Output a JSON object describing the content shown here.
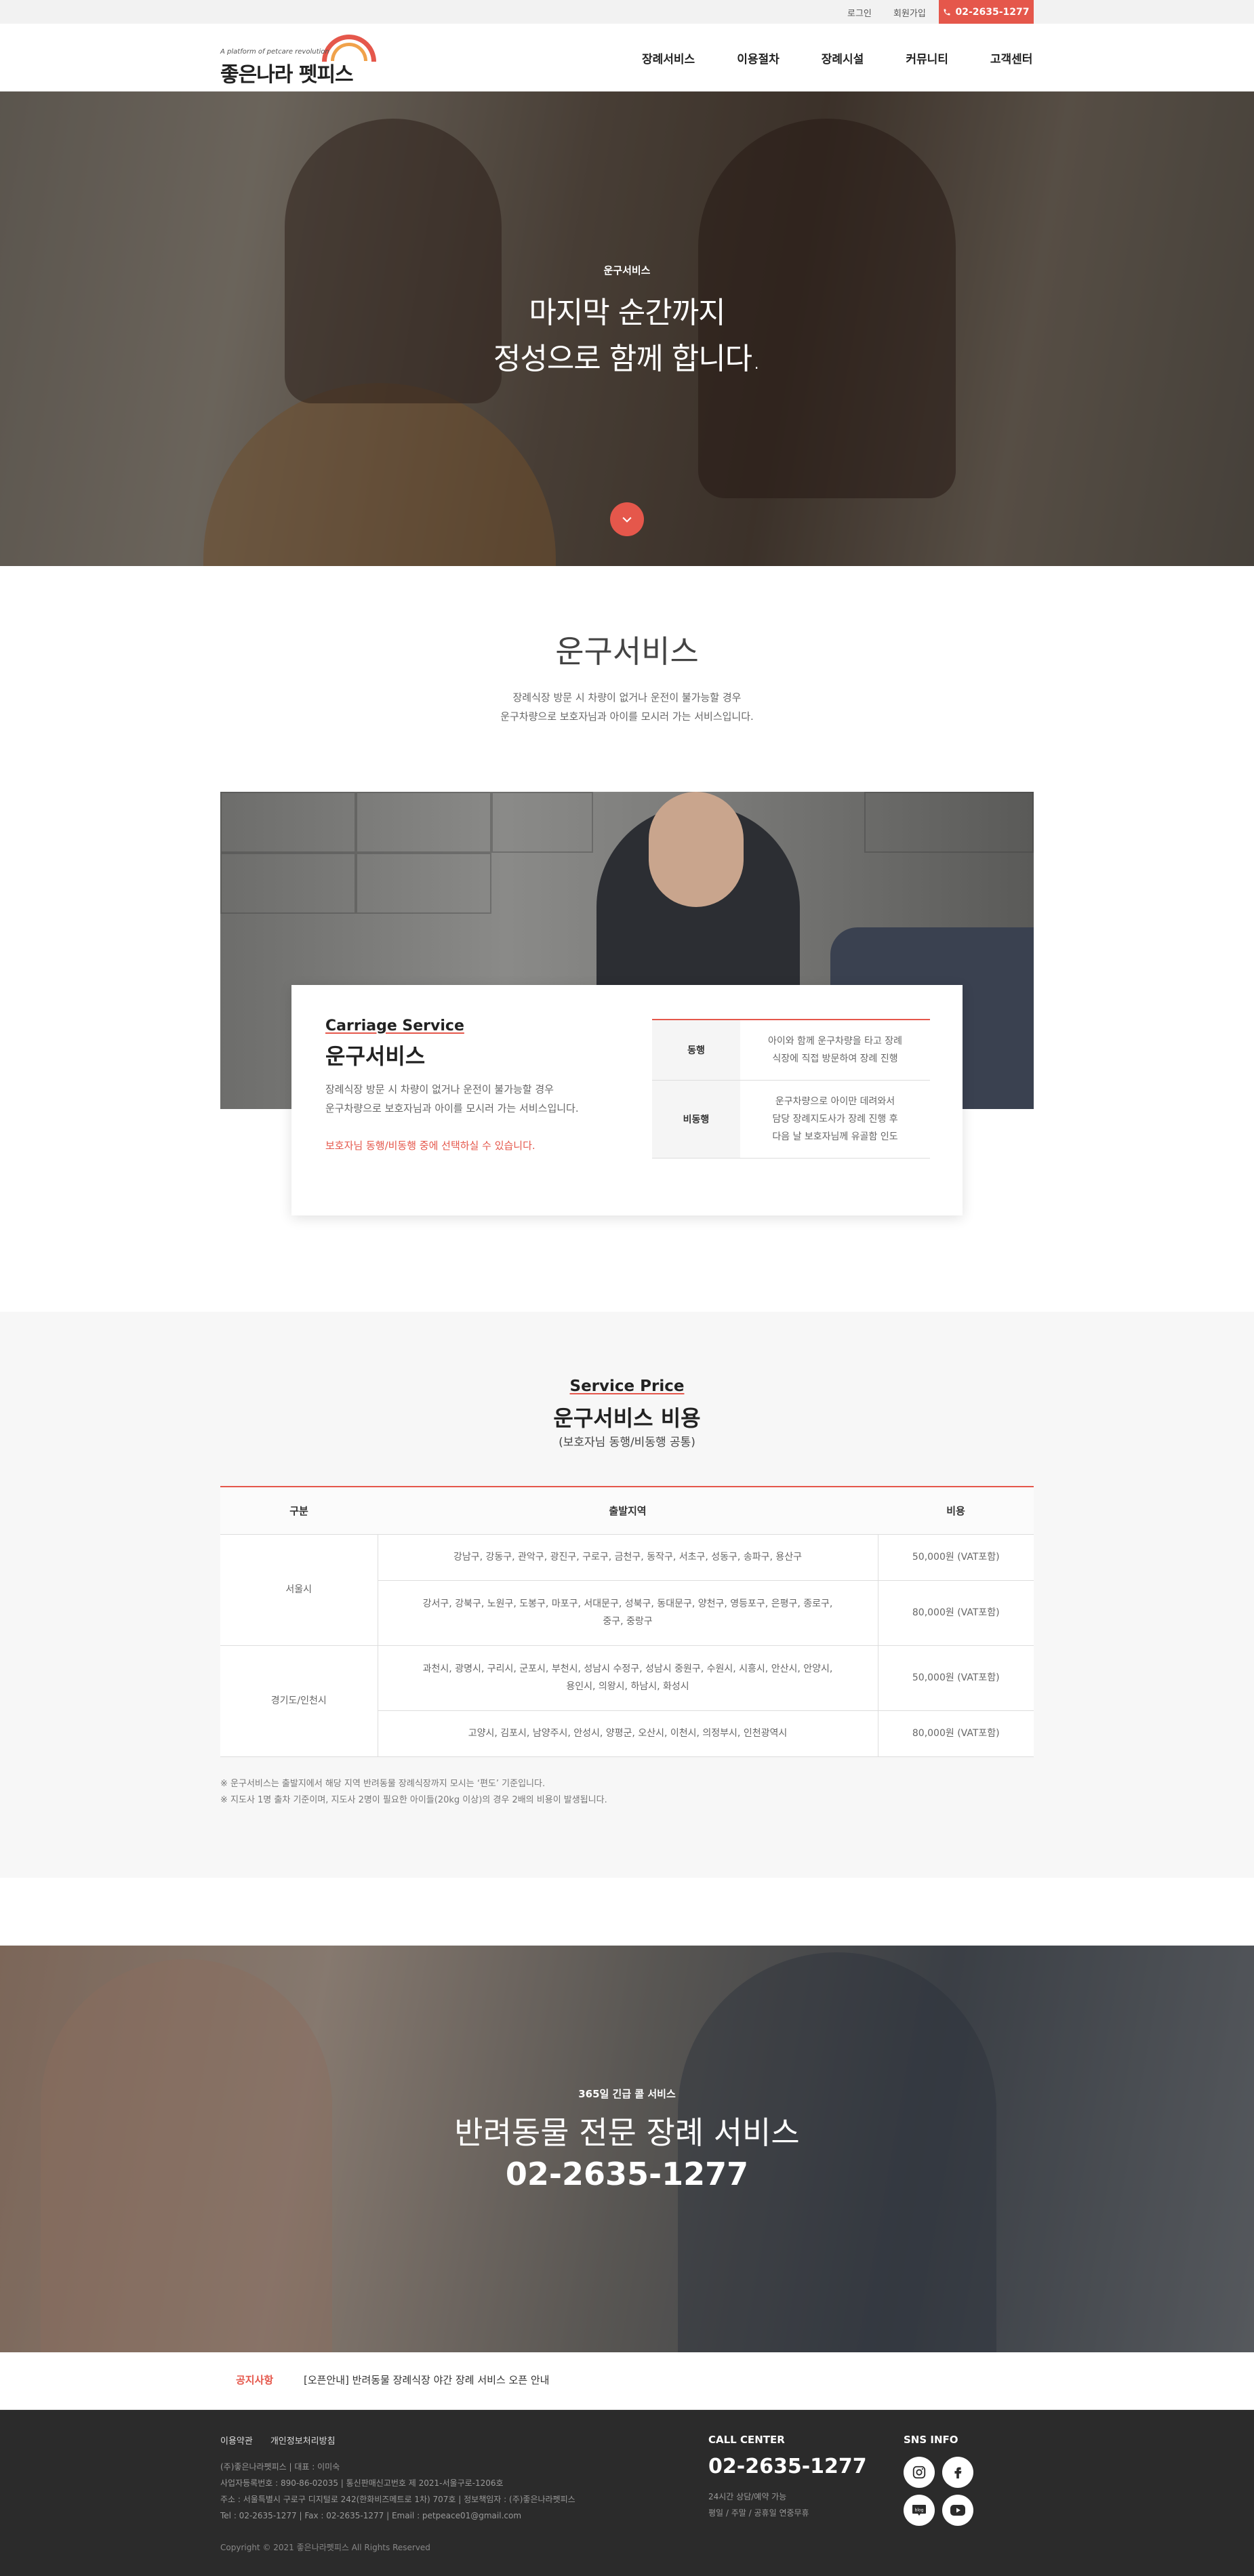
{
  "topbar": {
    "login": "로그인",
    "signup": "회원가입",
    "phone": "02-2635-1277"
  },
  "header": {
    "logo_tagline": "A platform of petcare revolution",
    "logo_name": "좋은나라 펫피스",
    "nav": [
      "장례서비스",
      "이용절차",
      "장례시설",
      "커뮤니티",
      "고객센터"
    ]
  },
  "hero": {
    "kicker": "운구서비스",
    "line1": "마지막 순간까지",
    "line2": "정성으로 함께 합니다."
  },
  "intro": {
    "title": "운구서비스",
    "desc1": "장례식장 방문 시 차량이 없거나 운전이 불가능할 경우",
    "desc2": "운구차량으로 보호자님과 아이를 모시러 가는 서비스입니다."
  },
  "carriage": {
    "title_en": "Carriage Service",
    "title_ko": "운구서비스",
    "desc1": "장례식장 방문 시 차량이 없거나 운전이 불가능할 경우",
    "desc2": "운구차량으로 보호자님과 아이를 모시러 가는 서비스입니다.",
    "note": "보호자님 동행/비동행 중에 선택하실 수 있습니다.",
    "rows": [
      {
        "key": "동행",
        "line1": "아이와 함께 운구차량을 타고 장례",
        "line2": "식장에 직접 방문하여 장례 진행"
      },
      {
        "key": "비동행",
        "line1": "운구차량으로 아이만 데려와서",
        "line2": "담당 장례지도사가 장례 진행 후",
        "line3": "다음 날 보호자님께 유골함 인도"
      }
    ]
  },
  "price": {
    "title_en": "Service Price",
    "title_ko": "운구서비스 비용",
    "subtitle": "(보호자님 동행/비동행 공통)",
    "headers": [
      "구분",
      "출발지역",
      "비용"
    ],
    "groups": [
      {
        "region": "서울시",
        "rows": [
          {
            "area": "강남구, 강동구, 관악구, 광진구, 구로구, 금천구, 동작구, 서초구, 성동구, 송파구, 용산구",
            "area2": "",
            "cost": "50,000원 (VAT포함)"
          },
          {
            "area": "강서구, 강북구, 노원구, 도봉구, 마포구, 서대문구, 성북구, 동대문구, 양천구, 영등포구, 은평구, 종로구,",
            "area2": "중구, 중랑구",
            "cost": "80,000원 (VAT포함)"
          }
        ]
      },
      {
        "region": "경기도/인천시",
        "rows": [
          {
            "area": "과천시, 광명시, 구리시, 군포시, 부천시, 성남시 수정구, 성남시 중원구, 수원시, 시흥시, 안산시, 안양시,",
            "area2": "용인시, 의왕시, 하남시, 화성시",
            "cost": "50,000원 (VAT포함)"
          },
          {
            "area": "고양시, 김포시, 남양주시, 안성시, 양평군, 오산시, 이천시, 의정부시, 인천광역시",
            "area2": "",
            "cost": "80,000원 (VAT포함)"
          }
        ]
      }
    ],
    "note1": "※ 운구서비스는 출발지에서 해당 지역 반려동물 장례식장까지 모시는 ‘편도’ 기준입니다.",
    "note2": "※ 지도사 1명 출차 기준이며, 지도사 2명이 필요한 아이들(20kg 이상)의 경우 2배의 비용이 발생됩니다."
  },
  "call": {
    "kicker": "365일 긴급 콜 서비스",
    "title": "반려동물 전문 장례 서비스",
    "phone": "02-2635-1277"
  },
  "notice": {
    "label": "공지사항",
    "text": "[오픈안내] 반려동물 장례식장 야간 장례 서비스 오픈 안내"
  },
  "footer": {
    "links": [
      "이용약관",
      "개인정보처리방침"
    ],
    "info1": "(주)좋은나라펫피스 | 대표 : 이미숙",
    "info2": "사업자등록번호 : 890-86-02035 | 통신판매신고번호 제 2021-서울구로-1206호",
    "info3": "주소 : 서울특별시 구로구 디지털로 242(한화비즈메트로 1차) 707호 | 정보책임자 : (주)좋은나라펫피스",
    "info4": "Tel : 02-2635-1277 | Fax : 02-2635-1277 | Email : petpeace01@gmail.com",
    "copyright": "Copyright © 2021 좋은나라펫피스 All Rights Reserved",
    "cc_label": "CALL CENTER",
    "cc_phone": "02-2635-1277",
    "cc_hours1": "24시간 상담/예약 가능",
    "cc_hours2": "평일 / 주말 / 공휴일 연중무휴",
    "sns_label": "SNS INFO",
    "sns_icons": [
      "instagram-icon",
      "facebook-icon",
      "blog-icon",
      "youtube-icon"
    ]
  },
  "colors": {
    "accent": "#e5574b",
    "footer_bg": "#2b2b2b",
    "price_bg": "#f7f7f7"
  }
}
